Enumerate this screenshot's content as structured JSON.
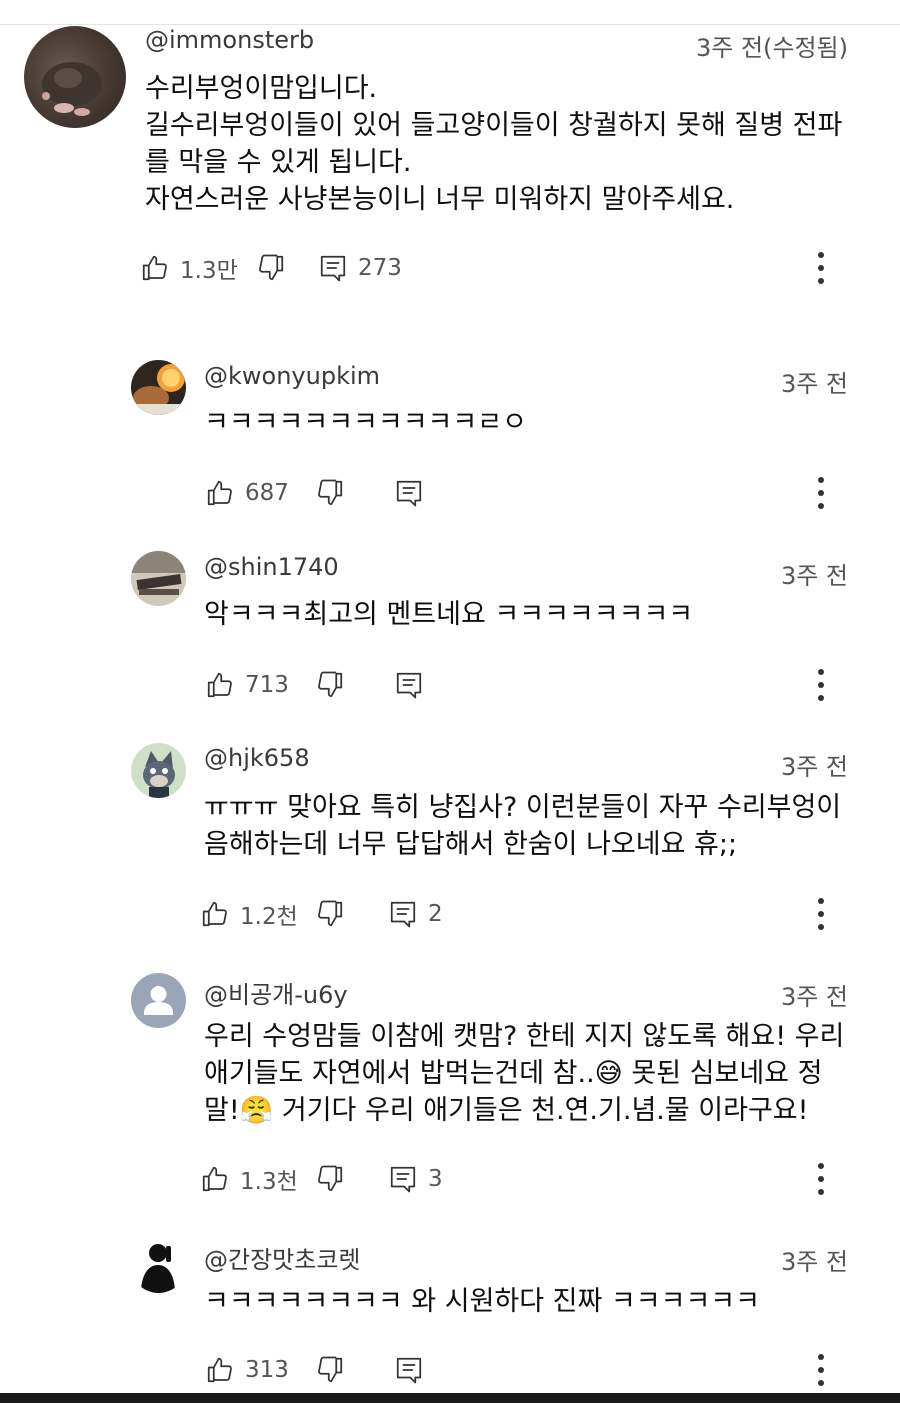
{
  "comments": [
    {
      "author": "@immonsterb",
      "time": "3주 전(수정됨)",
      "text": "수리부엉이맘입니다.\n길수리부엉이들이 있어 들고양이들이 창궐하지 못해 질병 전파\n를 막을 수 있게 됩니다.\n자연스러운 사냥본능이니 너무 미워하지 말아주세요.",
      "likes": "1.3만",
      "replies": "273",
      "avatar": "mole-photo"
    },
    {
      "author": "@kwonyupkim",
      "time": "3주 전",
      "text": "ㅋㅋㅋㅋㅋㅋㅋㅋㅋㅋㅋㄹㅇ",
      "likes": "687",
      "replies": "",
      "avatar": "food-photo"
    },
    {
      "author": "@shin1740",
      "time": "3주 전",
      "text": "악ㅋㅋㅋ최고의 멘트네요 ㅋㅋㅋㅋㅋㅋㅋㅋ",
      "likes": "713",
      "replies": "",
      "avatar": "room-photo"
    },
    {
      "author": "@hjk658",
      "time": "3주 전",
      "text": "ㅠㅠㅠ 맞아요 특히 냥집사? 이런분들이 자꾸 수리부엉이\n음해하는데 너무 답답해서 한숨이 나오네요 휴;;",
      "likes": "1.2천",
      "replies": "2",
      "avatar": "cartoon-cat"
    },
    {
      "author": "@비공개-u6y",
      "time": "3주 전",
      "text": "우리 수엉맘들 이참에 캣맘? 한테 지지 않도록 해요! 우리\n애기들도 자연에서 밥먹는건데 참..😅 못된 심보네요 정\n말!😤 거기다 우리 애기들은 천.연.기.념.물 이라구요!",
      "likes": "1.3천",
      "replies": "3",
      "avatar": "default-person"
    },
    {
      "author": "@간장맛초코렛",
      "time": "3주 전",
      "text": "ㅋㅋㅋㅋㅋㅋㅋㅋ  와 시원하다 진짜 ㅋㅋㅋㅋㅋㅋ",
      "likes": "313",
      "replies": "",
      "avatar": "silhouette"
    }
  ],
  "icons": {
    "like": "thumbs-up-icon",
    "dislike": "thumbs-down-icon",
    "reply": "reply-icon",
    "more": "more-vert-icon"
  },
  "colors": {
    "text": "#0f0f0f",
    "secondary": "#555555",
    "default_avatar": "#9aa6b7"
  }
}
